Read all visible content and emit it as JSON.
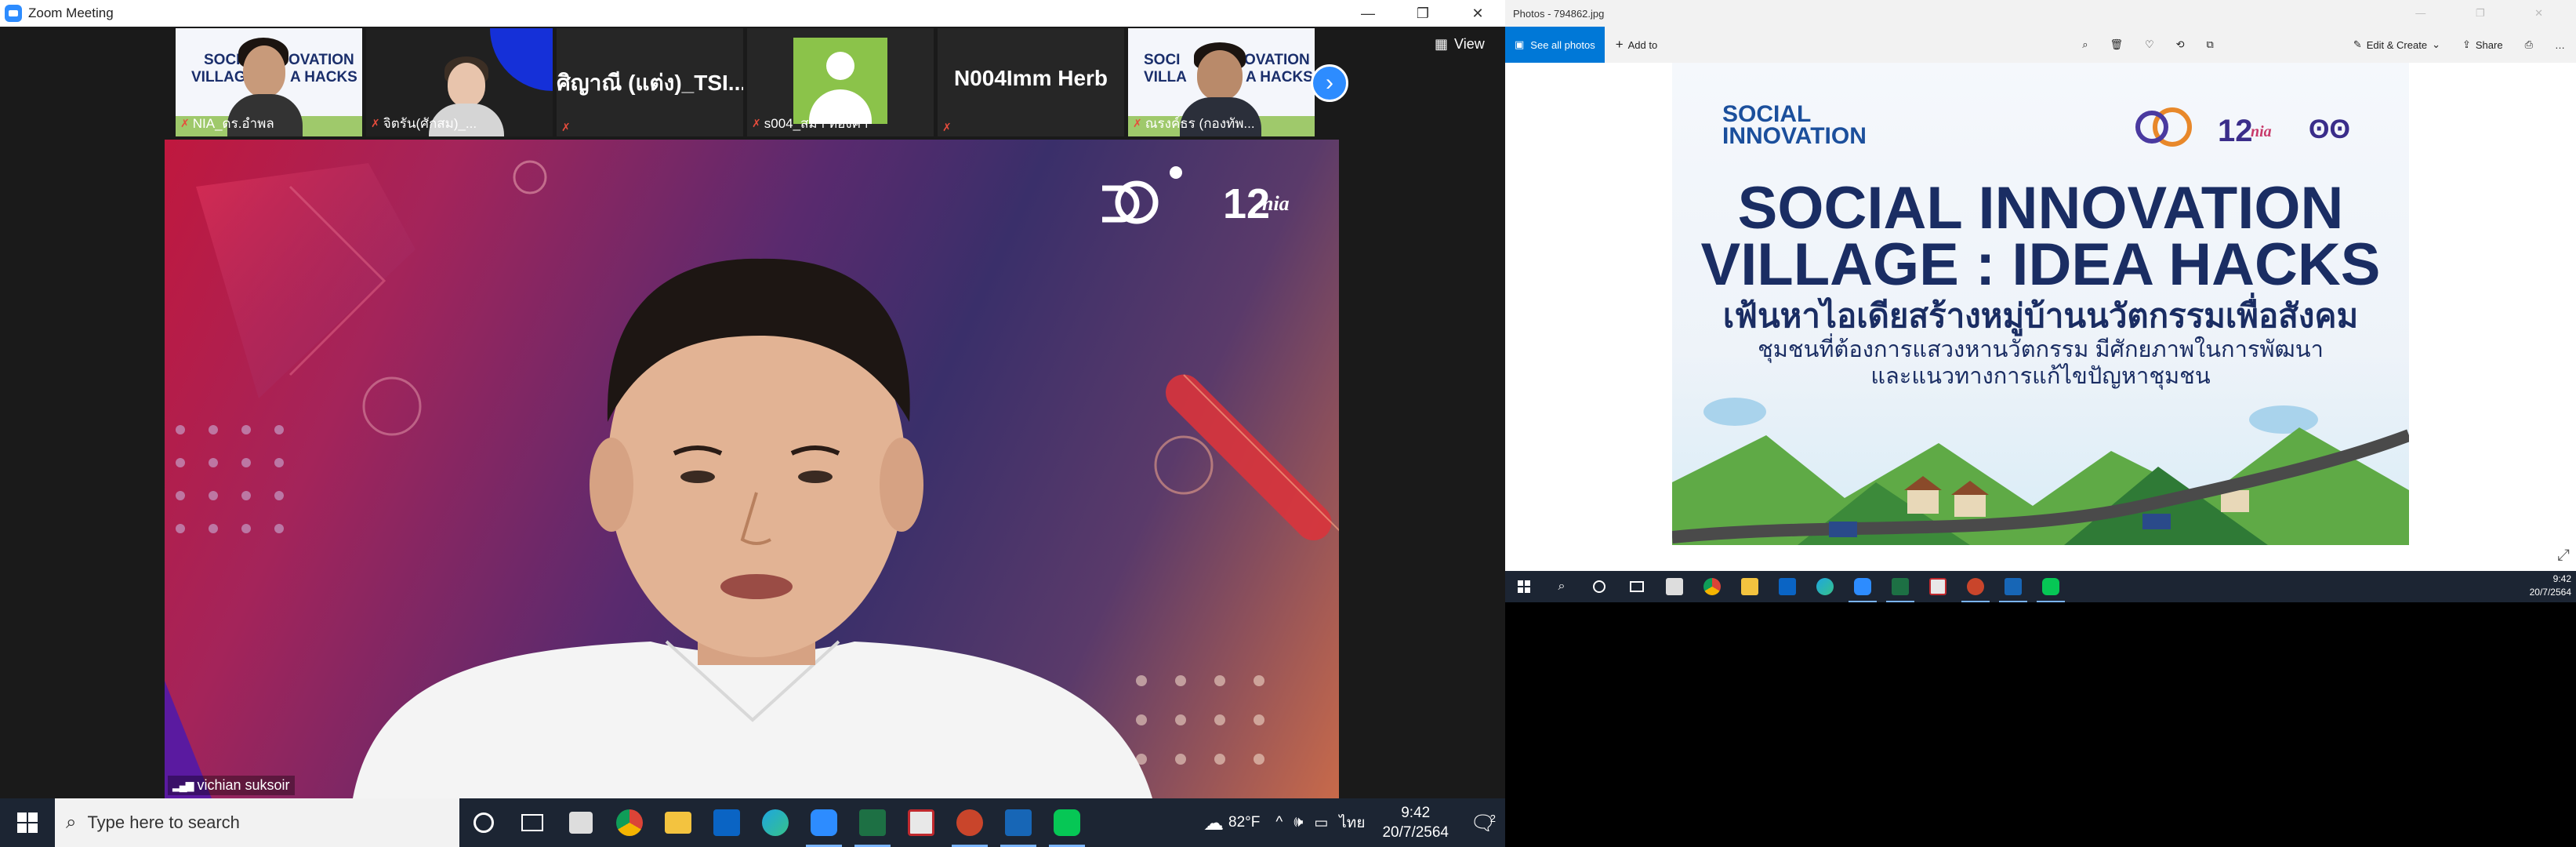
{
  "zoom": {
    "title": "Zoom Meeting",
    "view_label": "View",
    "thumbnails": [
      {
        "label": "NIA_ดร.อำพล",
        "poster_text": "SOCIAL INNOVATION VILLAGE : IDEA HACKS",
        "type": "poster-person"
      },
      {
        "label": "จิตรัน(ศักสม)_...",
        "type": "person"
      },
      {
        "label": "",
        "display_name": "ศิญาณี (แต่ง)_TSI...",
        "type": "name"
      },
      {
        "label": "s004_สมา ทองคำ",
        "type": "avatar"
      },
      {
        "label": "",
        "display_name": "N004Imm Herb",
        "type": "name"
      },
      {
        "label": "ณรงค์ธร (กองทัพ...",
        "poster_text": "SOCIAL INNOVATION VILLAGE : IDEA HACKS",
        "type": "poster-person"
      }
    ],
    "speaker_name": "vichian suksoir"
  },
  "taskbar": {
    "search_placeholder": "Type here to search",
    "weather": "82°F",
    "language": "ไทย",
    "time": "9:42",
    "date": "20/7/2564",
    "notification_count": "2"
  },
  "photos": {
    "title": "Photos - 794862.jpg",
    "see_all": "See all photos",
    "add_to": "Add to",
    "edit_create": "Edit & Create",
    "share": "Share",
    "poster": {
      "logo_line1": "SOCIAL",
      "logo_line2": "INNOVATION",
      "headline1": "SOCIAL INNOVATION",
      "headline2": "VILLAGE : IDEA HACKS",
      "thai_title": "เฟ้นหาไอเดียสร้างหมู่บ้านนวัตกรรมเพื่อสังคม",
      "thai_sub1": "ชุมชนที่ต้องการแสวงหานวัตกรรม มีศักยภาพในการพัฒนา",
      "thai_sub2": "และแนวทางการแก้ไขปัญหาชุมชน"
    },
    "taskbar_time": "9:42",
    "taskbar_date": "20/7/2564"
  }
}
